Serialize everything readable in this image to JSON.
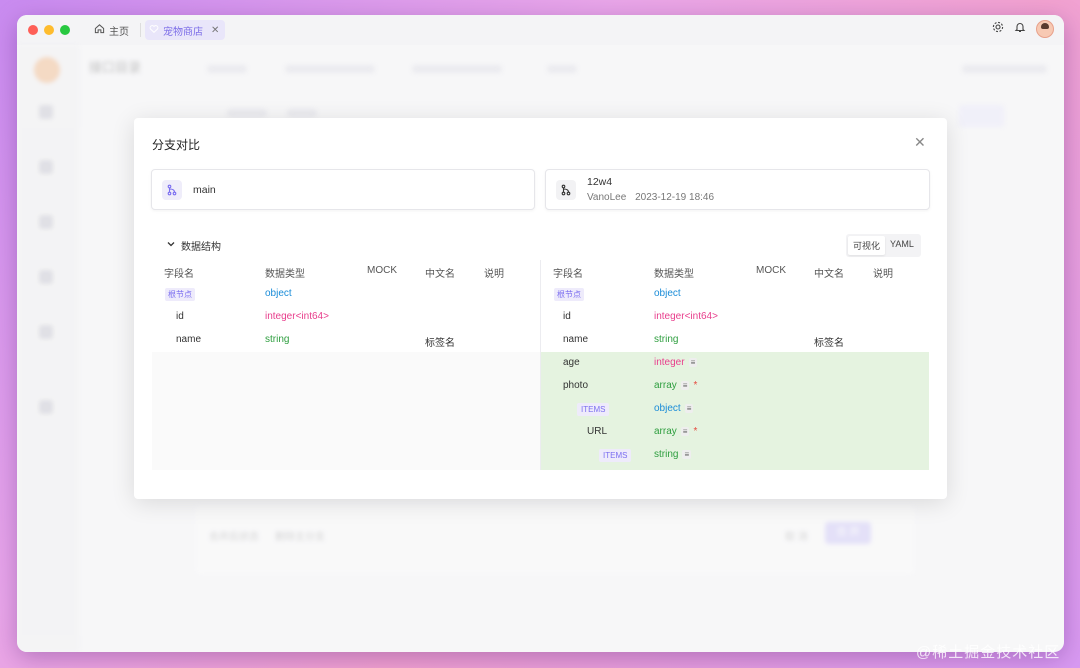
{
  "titlebar": {
    "home_tab": "主页",
    "active_tab": "宠物商店"
  },
  "background": {
    "page_title": "接口目录",
    "merge_status_label": "合并后状态",
    "merge_status_value": "删除主分支",
    "cancel_label": "取 消",
    "submit_label": "合 并"
  },
  "modal": {
    "title": "分支对比",
    "left_branch": {
      "name": "main"
    },
    "right_branch": {
      "name": "12w4",
      "author": "VanoLee",
      "time": "2023-12-19 18:46"
    },
    "section_title": "数据结构",
    "view_toggle": [
      "可视化",
      "YAML"
    ],
    "columns": [
      "字段名",
      "数据类型",
      "MOCK",
      "中文名",
      "说明"
    ],
    "left_rows": [
      {
        "name": "根节点",
        "type": "object",
        "cn": ""
      },
      {
        "name": "id",
        "type": "integer<int64>",
        "cn": ""
      },
      {
        "name": "name",
        "type": "string",
        "cn": "标签名"
      }
    ],
    "right_rows": [
      {
        "name": "根节点",
        "type": "object",
        "cn": ""
      },
      {
        "name": "id",
        "type": "integer<int64>",
        "cn": ""
      },
      {
        "name": "name",
        "type": "string",
        "cn": "标签名"
      },
      {
        "name": "age",
        "type": "integer"
      },
      {
        "name": "photo",
        "type": "array"
      },
      {
        "name": "ITEMS",
        "type": "object"
      },
      {
        "name": "URL",
        "type": "array"
      },
      {
        "name": "ITEMS",
        "type": "string"
      }
    ]
  },
  "watermark": "@稀土掘金技术社区"
}
